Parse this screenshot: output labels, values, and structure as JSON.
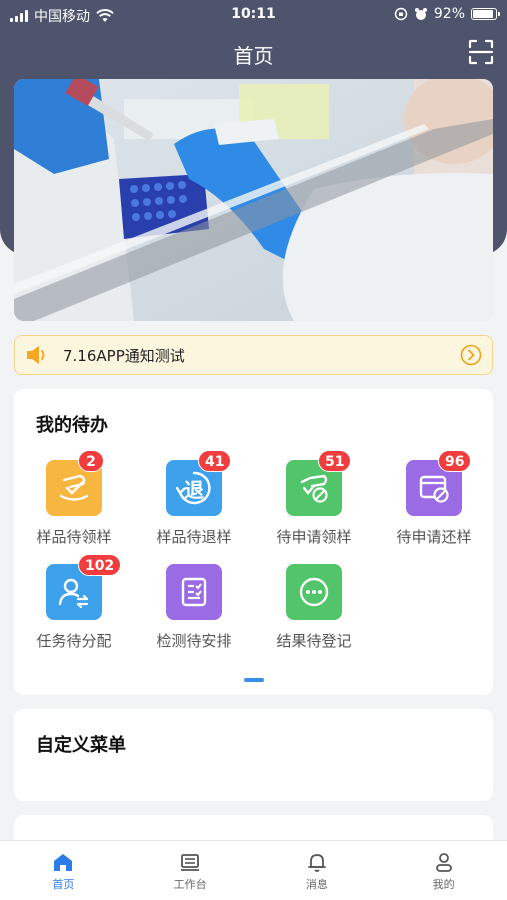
{
  "status_bar": {
    "carrier": "中国移动",
    "time": "10:11",
    "battery": "92%",
    "battery_level": 0.92
  },
  "nav": {
    "title": "首页",
    "scan_icon": "scan-icon"
  },
  "banner": {
    "image": "laboratory-photo",
    "description_icon": "lab-pipette-image"
  },
  "notice": {
    "text": "7.16APP通知测试",
    "icon": "speaker-icon",
    "accent": "#f5a623"
  },
  "todo": {
    "title": "我的待办",
    "items": [
      {
        "label": "样品待领样",
        "badge": "2",
        "icon": "sample-receive-icon",
        "color": "#f6b640"
      },
      {
        "label": "样品待退样",
        "badge": "41",
        "icon": "sample-return-icon",
        "color": "#3ea1ec",
        "glyph": "退"
      },
      {
        "label": "待申请领样",
        "badge": "51",
        "icon": "apply-receive-icon",
        "color": "#52c46a"
      },
      {
        "label": "待申请还样",
        "badge": "96",
        "icon": "apply-return-icon",
        "color": "#9b6be6"
      },
      {
        "label": "任务待分配",
        "badge": "102",
        "icon": "task-assign-icon",
        "color": "#3ea1ec"
      },
      {
        "label": "检测待安排",
        "badge": "",
        "icon": "test-schedule-icon",
        "color": "#9b6be6"
      },
      {
        "label": "结果待登记",
        "badge": "",
        "icon": "result-register-icon",
        "color": "#52c46a"
      }
    ]
  },
  "custom_menu": {
    "title": "自定义菜单"
  },
  "tabbar": {
    "items": [
      {
        "label": "首页",
        "icon": "home-icon",
        "active": true
      },
      {
        "label": "工作台",
        "icon": "workbench-icon",
        "active": false
      },
      {
        "label": "消息",
        "icon": "bell-icon",
        "active": false
      },
      {
        "label": "我的",
        "icon": "user-icon",
        "active": false
      }
    ]
  },
  "colors": {
    "header": "#4e546b",
    "accent": "#2b7ce9",
    "badge": "#f13d3d"
  }
}
